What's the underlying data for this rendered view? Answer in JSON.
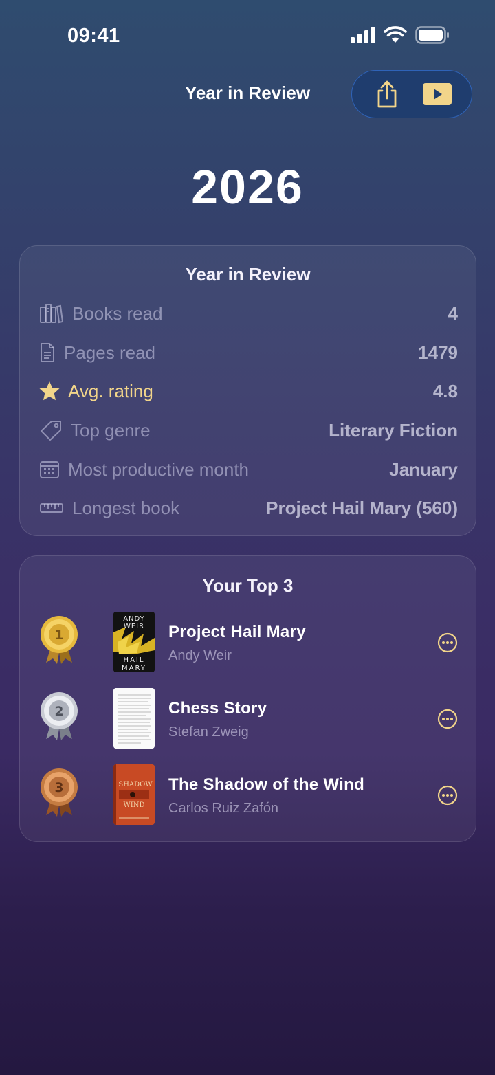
{
  "status_bar": {
    "time": "09:41",
    "icons": [
      "cellular-signal-icon",
      "wifi-icon",
      "battery-icon"
    ]
  },
  "nav": {
    "title": "Year in Review",
    "actions": [
      "share-icon",
      "play-icon"
    ]
  },
  "year": "2026",
  "stats": {
    "title": "Year in Review",
    "rows": [
      {
        "icon": "books-icon",
        "label": "Books read",
        "value": "4"
      },
      {
        "icon": "page-icon",
        "label": "Pages read",
        "value": "1479"
      },
      {
        "icon": "star-icon",
        "label": "Avg. rating",
        "value": "4.8"
      },
      {
        "icon": "tag-icon",
        "label": "Top genre",
        "value": "Literary Fiction"
      },
      {
        "icon": "calendar-icon",
        "label": "Most productive month",
        "value": "January"
      },
      {
        "icon": "ruler-icon",
        "label": "Longest book",
        "value": "Project Hail Mary (560)"
      }
    ]
  },
  "top3": {
    "title": "Your Top 3",
    "books": [
      {
        "rank": "1",
        "title": "Project Hail Mary",
        "author": "Andy Weir",
        "cover_lines": [
          "ANDY",
          "WEIR",
          "HAIL",
          "MARY"
        ]
      },
      {
        "rank": "2",
        "title": "Chess Story",
        "author": "Stefan Zweig"
      },
      {
        "rank": "3",
        "title": "The Shadow of the Wind",
        "author": "Carlos Ruiz Zafón",
        "cover_lines": [
          "SHADOW",
          "WIND"
        ]
      }
    ]
  },
  "colors": {
    "accent": "#f2d58a",
    "gold": "#d9a932",
    "silver": "#b8bcc6",
    "bronze": "#b86e3a",
    "pill_bg": "#1f3d6e"
  }
}
